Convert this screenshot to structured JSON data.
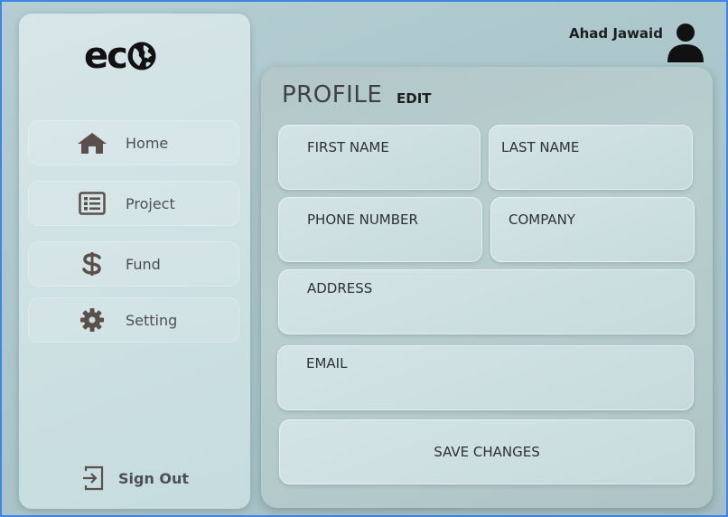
{
  "logo": {
    "text": "ec"
  },
  "user": {
    "name": "Ahad Jawaid"
  },
  "sidebar": {
    "items": [
      {
        "label": "Home",
        "icon": "home-icon"
      },
      {
        "label": "Project",
        "icon": "list-icon"
      },
      {
        "label": "Fund",
        "icon": "dollar-icon"
      },
      {
        "label": "Setting",
        "icon": "gear-icon"
      }
    ],
    "signout_label": "Sign Out"
  },
  "profile": {
    "title": "PROFILE",
    "edit_label": "EDIT",
    "fields": {
      "first_name": "FIRST NAME",
      "last_name": "LAST NAME",
      "phone": "PHONE NUMBER",
      "company": "COMPANY",
      "address": "ADDRESS",
      "email": "EMAIL"
    },
    "save_label": "SAVE CHANGES"
  },
  "colors": {
    "accent": "#3d86e6",
    "icon": "#5a4f4b",
    "text": "#4d4f50"
  }
}
